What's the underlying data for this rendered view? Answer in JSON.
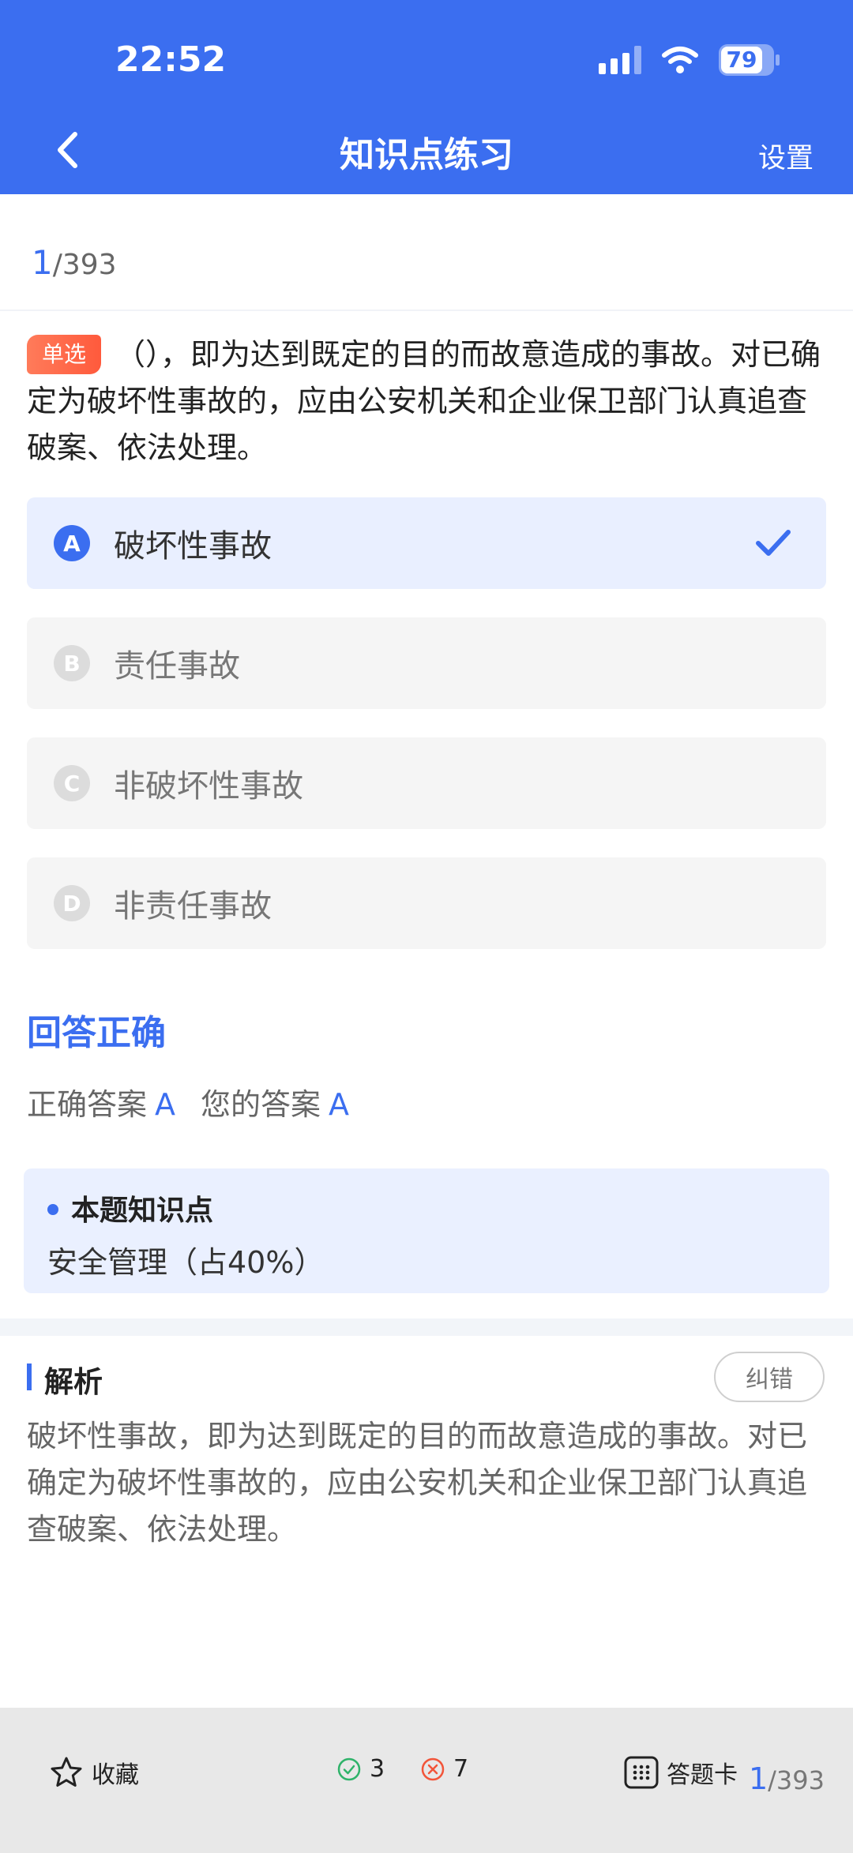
{
  "status_bar": {
    "time": "22:52",
    "battery": "79"
  },
  "nav": {
    "title": "知识点练习",
    "settings": "设置"
  },
  "progress": {
    "current": "1",
    "total": "/393"
  },
  "question": {
    "tag": "单选",
    "text": "（），即为达到既定的目的而故意造成的事故。对已确定为破坏性事故的，应由公安机关和企业保卫部门认真追查破案、依法处理。"
  },
  "options": [
    {
      "letter": "A",
      "text": "破坏性事故",
      "selected": true
    },
    {
      "letter": "B",
      "text": "责任事故"
    },
    {
      "letter": "C",
      "text": "非破坏性事故"
    },
    {
      "letter": "D",
      "text": "非责任事故"
    }
  ],
  "result": {
    "title": "回答正确",
    "correct_label": "正确答案",
    "correct_value": "A",
    "your_label": "您的答案",
    "your_value": "A"
  },
  "knowledge_point": {
    "title": "本题知识点",
    "text": "安全管理（占40%）"
  },
  "analysis": {
    "title": "解析",
    "report_button": "纠错",
    "text": "破坏性事故，即为达到既定的目的而故意造成的事故。对已确定为破坏性事故的，应由公安机关和企业保卫部门认真追查破案、依法处理。"
  },
  "bottom_bar": {
    "favorite": "收藏",
    "right_count": "3",
    "wrong_count": "7",
    "answer_card": "答题卡",
    "page_current": "1",
    "page_total": "/393"
  },
  "colors": {
    "primary": "#3b6ef0",
    "tag": "#ff5a3c",
    "correct": "#2fb36a",
    "wrong": "#f2553a"
  }
}
